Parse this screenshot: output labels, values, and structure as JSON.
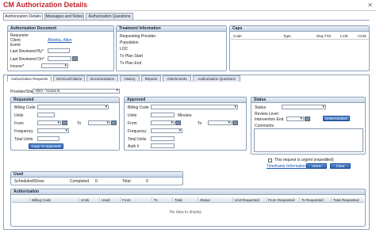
{
  "window": {
    "title": "CM Authorization Details"
  },
  "top_tabs": [
    "Authorization Details",
    "Messages and Notes",
    "Authorization Questions"
  ],
  "auth_doc": {
    "header": "Authorization Document",
    "requestor_label": "Requestor",
    "client_label": "Client",
    "client_value": "Allotrba, Allen",
    "event_label": "Event",
    "last_reviewed_by_label": "Last Reviewed By*",
    "last_reviewed_on_label": "Last Reviewed On*",
    "insurer_label": "Insurer*"
  },
  "treatment": {
    "header": "Treatment Information",
    "labels": [
      "Requesting Provider",
      "Population",
      "LOC",
      "Tx Plan Start",
      "Tx Plan End"
    ]
  },
  "caps": {
    "header": "Caps",
    "columns": [
      "Code",
      "Type",
      "Req YTD",
      "LCM",
      "CCM"
    ]
  },
  "sub_tabs": [
    "Authorization Requests",
    "Services/Claims",
    "Documentation",
    "History",
    "Reports",
    "Attachments",
    "Authorization Questions"
  ],
  "provider_site": {
    "label": "Provider/Site",
    "value": "Allen - House B"
  },
  "requested": {
    "header": "Requested",
    "billing_code": "Billing Code",
    "units": "Units",
    "from": "From",
    "to": "To",
    "frequency": "Frequency",
    "total_units": "Total Units",
    "copy_button": "Copy To Approved"
  },
  "approved": {
    "header": "Approved",
    "billing_code": "Billing Code",
    "units": "Units",
    "minutes": "Minutes",
    "from": "From",
    "to": "To",
    "frequency": "Frequency",
    "total_units": "Total Units",
    "auth_no": "Auth #"
  },
  "status": {
    "header": "Status",
    "status_label": "Status",
    "review_level": "Review Level",
    "intervention_end": "Intervention End",
    "determination_button": "Determination",
    "comments": "Comments"
  },
  "urgent": {
    "label": "This request is urgent (expedited)"
  },
  "actions": {
    "timeframe_link": "Timeframe Information",
    "insert_button": "Insert",
    "clear_button": "Clear"
  },
  "used": {
    "header": "Used",
    "scheduled_label": "Scheduled/Show",
    "scheduled_value": "",
    "completed_label": "Completed",
    "completed_value": "0",
    "total_label": "Total",
    "total_value": "0"
  },
  "authorization": {
    "header": "Authorization",
    "columns": [
      "Billing Code",
      "Units",
      "Used",
      "From",
      "To",
      "Total",
      "Status",
      "Unit Requested",
      "From Requested",
      "To Requested",
      "Total Requested"
    ],
    "empty_text": "No data to display"
  },
  "colors": {
    "title": "#c0262d",
    "accent": "#2e63ad",
    "border": "#8fa3bb"
  }
}
